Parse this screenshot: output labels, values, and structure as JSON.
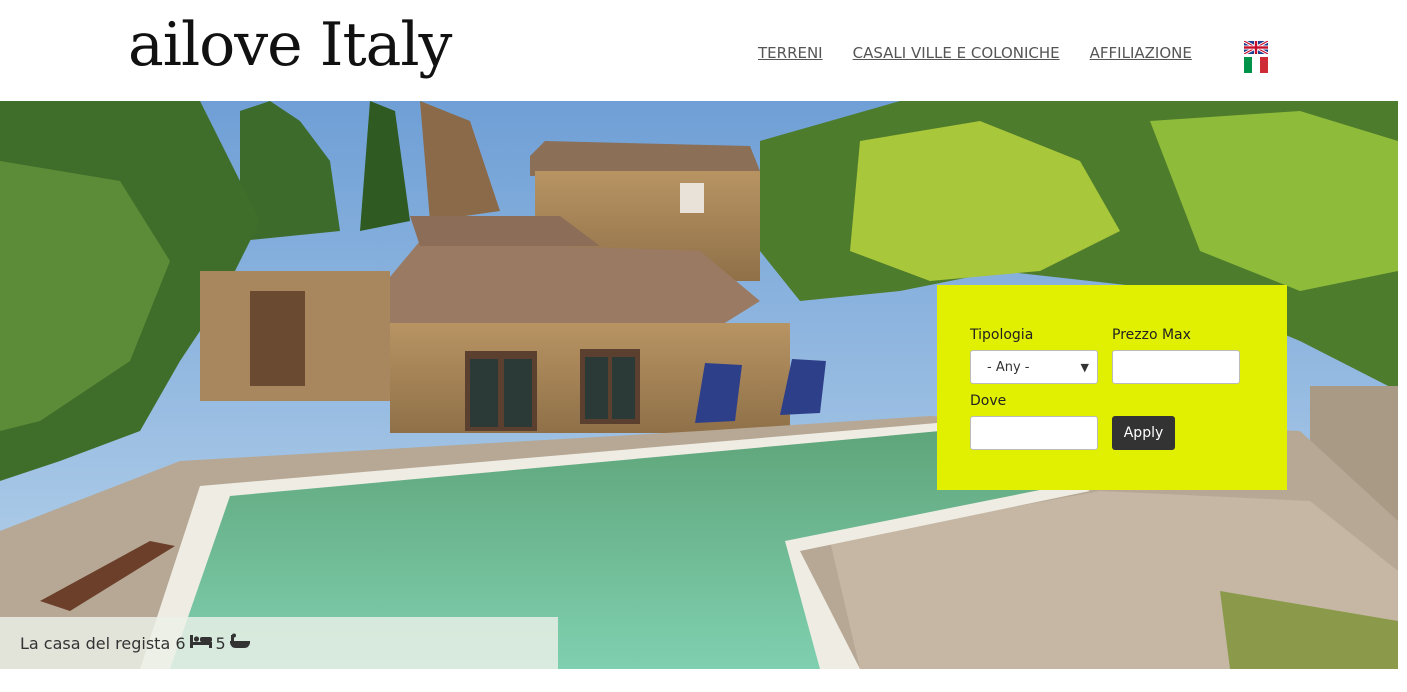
{
  "site": {
    "logo": "ailove Italy"
  },
  "nav": {
    "items": [
      "TERRENI",
      "CASALI VILLE E COLONICHE",
      "AFFILIAZIONE"
    ]
  },
  "flags": {
    "english": "uk-flag-icon",
    "italian": "it-flag-icon"
  },
  "search": {
    "tipologia_label": "Tipologia",
    "tipologia_value": "- Any -",
    "prezzo_label": "Prezzo Max",
    "prezzo_value": "",
    "dove_label": "Dove",
    "dove_value": "",
    "apply_label": "Apply",
    "panel_color": "#e1f000"
  },
  "featured": {
    "title": "La casa del regista",
    "bedrooms": "6",
    "bathrooms": "5",
    "bed_icon": "bed-icon",
    "bath_icon": "bathtub-icon"
  }
}
